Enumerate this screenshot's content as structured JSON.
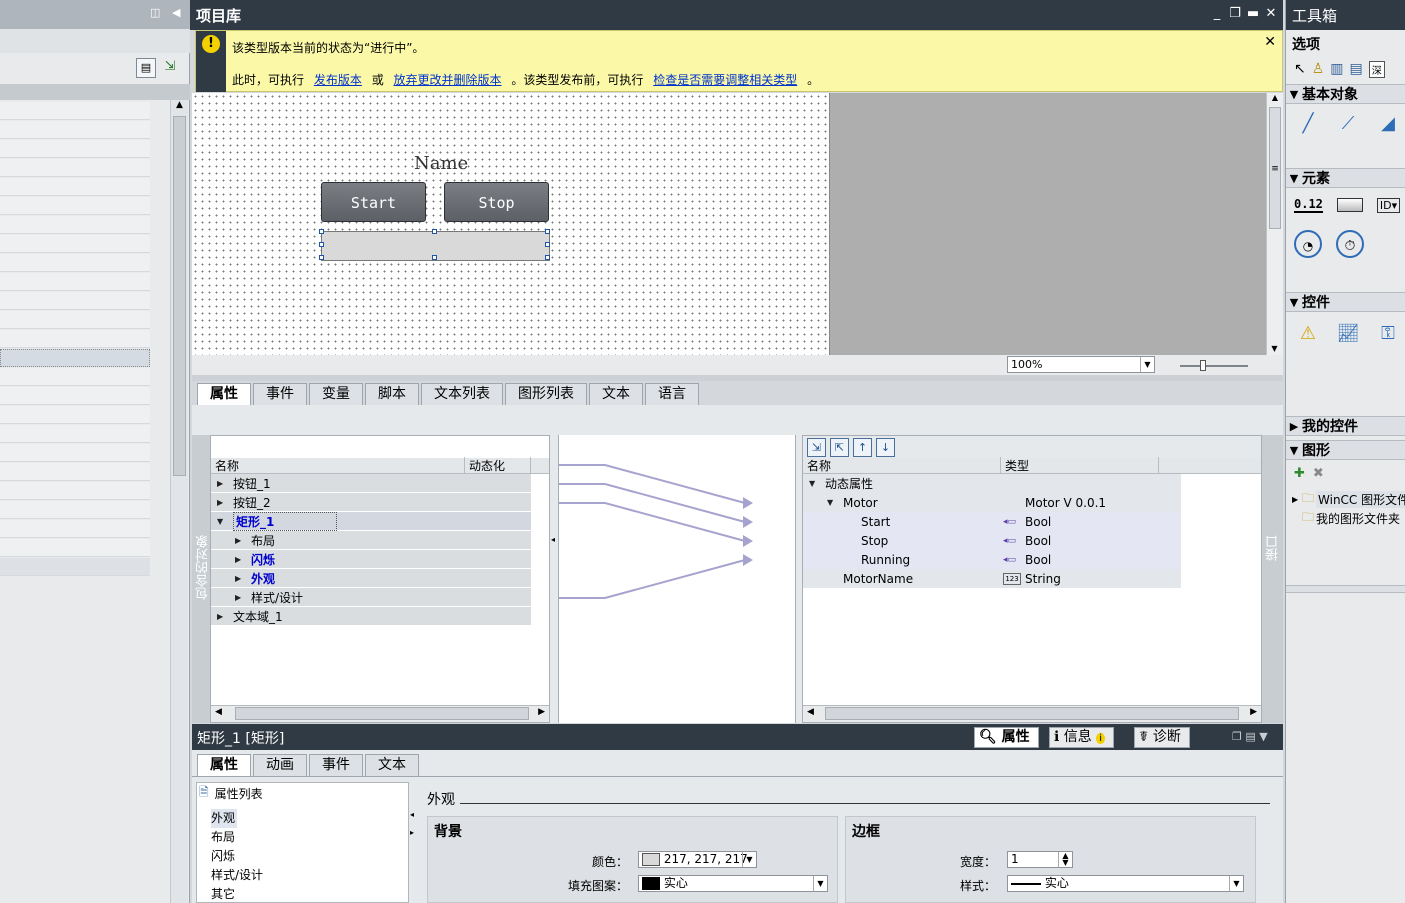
{
  "project_library": {
    "title": "项目库",
    "window_controls": [
      "_",
      "❐",
      "▬",
      "✕"
    ]
  },
  "banner": {
    "line1": "该类型版本当前的状态为“进行中”。",
    "line2_prefix": "此时，可执行",
    "link_publish": "发布版本",
    "or": "或",
    "link_discard": "放弃更改并删除版本",
    "line2_mid": "。该类型发布前，可执行",
    "link_check": "检查是否需要调整相关类型",
    "line2_end": "。"
  },
  "canvas": {
    "name_label": "Name",
    "start_label": "Start",
    "stop_label": "Stop",
    "zoom": "100%"
  },
  "editor_tabs": [
    "属性",
    "事件",
    "变量",
    "脚本",
    "文本列表",
    "图形列表",
    "文本",
    "语言"
  ],
  "left_tree": {
    "side_label": "包含的对象",
    "col_name": "名称",
    "col_dynamic": "动态化",
    "rows": [
      {
        "label": "按钮_1",
        "indent": 0,
        "arrow": "▶"
      },
      {
        "label": "按钮_2",
        "indent": 0,
        "arrow": "▶"
      },
      {
        "label": "矩形_1",
        "indent": 0,
        "arrow": "▼"
      },
      {
        "label": "布局",
        "indent": 1,
        "arrow": "▶"
      },
      {
        "label": "闪烁",
        "indent": 1,
        "arrow": "▶"
      },
      {
        "label": "外观",
        "indent": 1,
        "arrow": "▶"
      },
      {
        "label": "样式/设计",
        "indent": 1,
        "arrow": "▶"
      },
      {
        "label": "文本域_1",
        "indent": 0,
        "arrow": "▶"
      }
    ]
  },
  "right_tree": {
    "side_label": "接口",
    "col_name": "名称",
    "col_type": "类型",
    "toolbar": [
      "⇲",
      "⇱",
      "↑",
      "↓"
    ],
    "rows": [
      {
        "name": "动态属性",
        "type": "",
        "indent": 0,
        "arrow": "▼",
        "icon": ""
      },
      {
        "name": "Motor",
        "type": "Motor V 0.0.1",
        "indent": 1,
        "arrow": "▼",
        "icon": ""
      },
      {
        "name": "Start",
        "type": "Bool",
        "indent": 2,
        "arrow": "",
        "icon": "◂▭"
      },
      {
        "name": "Stop",
        "type": "Bool",
        "indent": 2,
        "arrow": "",
        "icon": "◂▭"
      },
      {
        "name": "Running",
        "type": "Bool",
        "indent": 2,
        "arrow": "",
        "icon": "◂▭"
      },
      {
        "name": "MotorName",
        "type": "String",
        "indent": 1,
        "arrow": "",
        "icon": "123"
      }
    ]
  },
  "inspector": {
    "title": "矩形_1 [矩形]",
    "header_tabs": [
      "属性",
      "信息",
      "诊断"
    ],
    "tabs": [
      "属性",
      "动画",
      "事件",
      "文本"
    ],
    "list_title": "属性列表",
    "list_items": [
      "外观",
      "布局",
      "闪烁",
      "样式/设计",
      "其它"
    ],
    "section_title": "外观",
    "background": {
      "title": "背景",
      "color_label": "颜色：",
      "color_value": "217, 217, 217",
      "fill_label": "填充图案：",
      "fill_value": "实心"
    },
    "border": {
      "title": "边框",
      "width_label": "宽度：",
      "width_value": "1",
      "style_label": "样式：",
      "style_value": "实心"
    }
  },
  "toolbox": {
    "title": "工具箱",
    "options_label": "选项",
    "sections": [
      "基本对象",
      "元素",
      "控件",
      "我的控件",
      "图形"
    ],
    "element_value": "0.12",
    "graphics_items": [
      "WinCC 图形文件",
      "我的图形文件夹"
    ]
  },
  "colors": {
    "titlebar": "#303a45",
    "banner": "#fbf9a8",
    "link": "#0033cc",
    "highlight": "#0000cc"
  }
}
